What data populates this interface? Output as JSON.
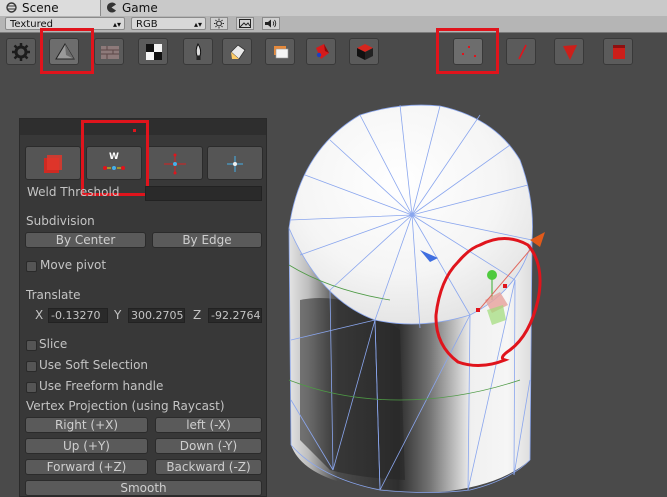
{
  "tabs": [
    {
      "label": "Scene",
      "icon": "scene-icon",
      "active": true
    },
    {
      "label": "Game",
      "icon": "pacman-icon",
      "active": false
    }
  ],
  "options": {
    "render_mode": "Textured",
    "color_mode": "RGB"
  },
  "panel": {
    "weld_label": "W",
    "weld_threshold_label": "Weld Threshold",
    "subdivision_label": "Subdivision",
    "by_center": "By Center",
    "by_edge": "By Edge",
    "move_pivot": "Move pivot",
    "translate_label": "Translate",
    "x_label": "X",
    "x_value": "-0.13270",
    "y_label": "Y",
    "y_value": "300.2705",
    "z_label": "Z",
    "z_value": "-92.2764",
    "slice": "Slice",
    "soft_selection": "Use Soft Selection",
    "freeform_handle": "Use Freeform handle",
    "projection_label": "Vertex Projection (using Raycast)",
    "right": "Right (+X)",
    "left": "left (-X)",
    "up": "Up (+Y)",
    "down": "Down (-Y)",
    "forward": "Forward (+Z)",
    "backward": "Backward (-Z)",
    "smooth": "Smooth"
  },
  "colors": {
    "highlight": "#e0141c",
    "wire": "#7f9fe8",
    "panel_bg": "#383838"
  }
}
